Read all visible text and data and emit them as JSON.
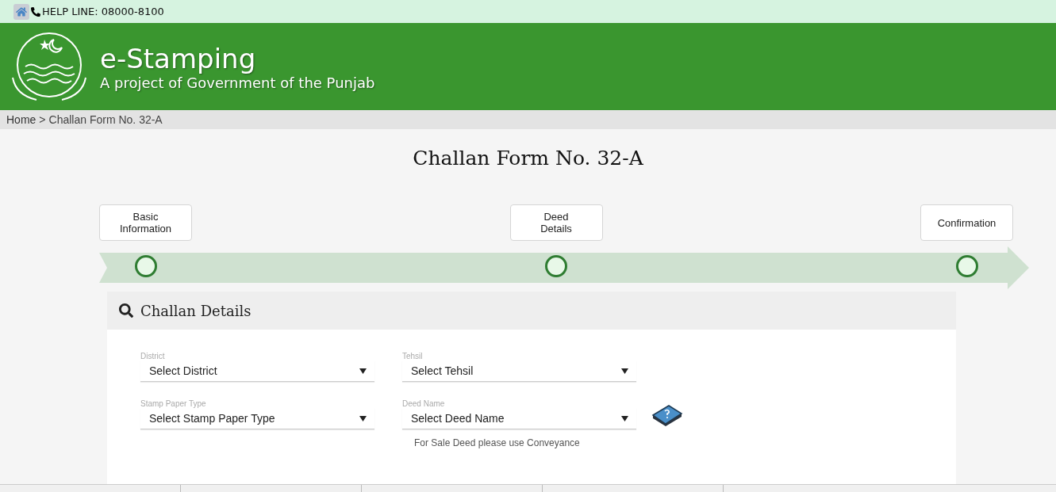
{
  "top_bar": {
    "helpline": "HELP LINE: 08000-8100"
  },
  "header": {
    "title": "e-Stamping",
    "subtitle": "A project of Government of the Punjab"
  },
  "breadcrumb": [
    "Home",
    ">",
    "Challan Form No. 32-A"
  ],
  "page_title": "Challan Form No. 32-A",
  "steps": [
    {
      "label": "Basic\nInformation",
      "selected": false
    },
    {
      "label": "Deed\nDetails",
      "selected": false
    },
    {
      "label": "Confirmation",
      "selected": false
    }
  ],
  "panel": {
    "title": "Challan Details",
    "fields": [
      {
        "label": "District",
        "value": "Select District"
      },
      {
        "label": "Tehsil",
        "value": "Select Tehsil"
      },
      {
        "label": "Stamp Paper Type",
        "value": "Select Stamp Paper Type"
      },
      {
        "label": "Deed Name",
        "value": "Select Deed Name",
        "help": true
      }
    ],
    "hint": "For Sale Deed please use Conveyance"
  }
}
